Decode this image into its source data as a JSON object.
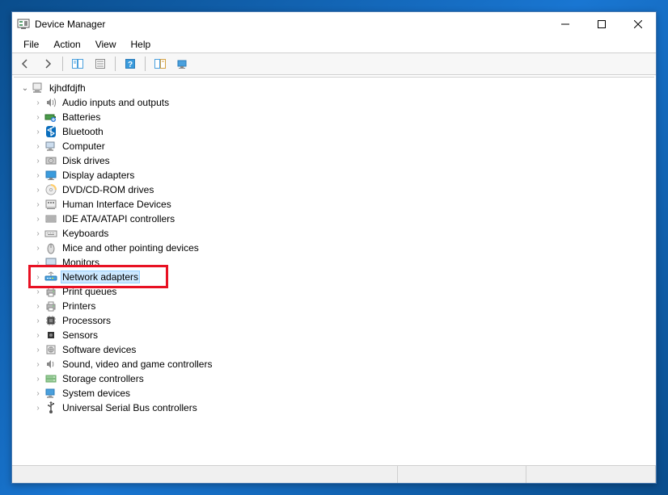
{
  "window": {
    "title": "Device Manager"
  },
  "menu": {
    "file": "File",
    "action": "Action",
    "view": "View",
    "help": "Help"
  },
  "tree": {
    "root": "kjhdfdjfh",
    "items": [
      {
        "label": "Audio inputs and outputs",
        "icon": "speaker"
      },
      {
        "label": "Batteries",
        "icon": "battery"
      },
      {
        "label": "Bluetooth",
        "icon": "bluetooth"
      },
      {
        "label": "Computer",
        "icon": "computer"
      },
      {
        "label": "Disk drives",
        "icon": "disk"
      },
      {
        "label": "Display adapters",
        "icon": "display"
      },
      {
        "label": "DVD/CD-ROM drives",
        "icon": "dvd"
      },
      {
        "label": "Human Interface Devices",
        "icon": "hid"
      },
      {
        "label": "IDE ATA/ATAPI controllers",
        "icon": "ide"
      },
      {
        "label": "Keyboards",
        "icon": "keyboard"
      },
      {
        "label": "Mice and other pointing devices",
        "icon": "mouse"
      },
      {
        "label": "Monitors",
        "icon": "monitor"
      },
      {
        "label": "Network adapters",
        "icon": "network",
        "selected": true,
        "highlighted": true
      },
      {
        "label": "Print queues",
        "icon": "printer"
      },
      {
        "label": "Printers",
        "icon": "printer"
      },
      {
        "label": "Processors",
        "icon": "cpu"
      },
      {
        "label": "Sensors",
        "icon": "sensor"
      },
      {
        "label": "Software devices",
        "icon": "software"
      },
      {
        "label": "Sound, video and game controllers",
        "icon": "sound"
      },
      {
        "label": "Storage controllers",
        "icon": "storage"
      },
      {
        "label": "System devices",
        "icon": "system"
      },
      {
        "label": "Universal Serial Bus controllers",
        "icon": "usb"
      }
    ]
  },
  "highlight_color": "#e81123"
}
